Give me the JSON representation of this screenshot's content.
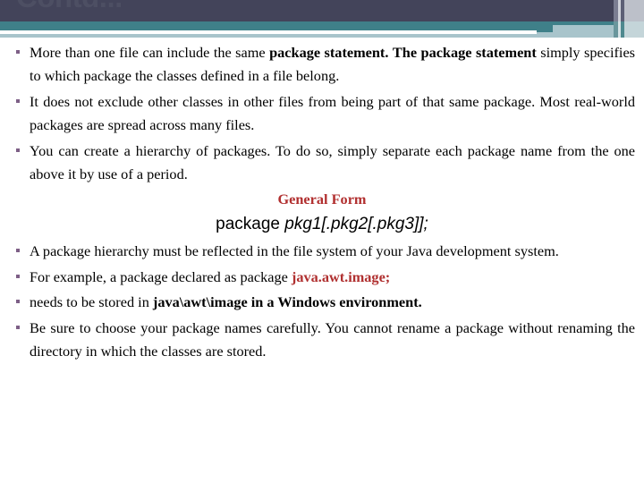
{
  "slide": {
    "title": "Contd...",
    "theme": {
      "band_dark": "#43445a",
      "band_teal": "#3f8089",
      "band_light_blue": "#a8c4cb",
      "title_color": "#4d4f63",
      "bullet_color": "#7d5f86",
      "accent_red": "#b12f2f",
      "body_color": "#000000"
    }
  },
  "body": {
    "bullets": [
      {
        "id": "bullet-package-statement",
        "segments": [
          {
            "text": "More than one file can include the same ",
            "style": "normal"
          },
          {
            "text": "package statement.",
            "style": "bold"
          },
          {
            "text": " ",
            "style": "normal"
          },
          {
            "text": "The package statement",
            "style": "bold"
          },
          {
            "text": " simply specifies to which package the classes defined in a file belong.",
            "style": "normal"
          }
        ]
      },
      {
        "id": "bullet-not-exclude",
        "segments": [
          {
            "text": "It does not exclude other classes in other files from being part of that same package. Most real-world packages are spread across many files.",
            "style": "normal"
          }
        ]
      },
      {
        "id": "bullet-hierarchy",
        "segments": [
          {
            "text": "You can create a hierarchy of packages. To do so, simply separate each package name from the one above it by use of a period.",
            "style": "normal"
          }
        ]
      }
    ],
    "general_form": {
      "label": "General Form",
      "syntax_keyword": "package ",
      "syntax_argument": "pkg1[.pkg2[.pkg3]];"
    },
    "bullets_after": [
      {
        "id": "bullet-file-system",
        "segments": [
          {
            "text": "A package hierarchy must be reflected in the file system of your Java development system.",
            "style": "normal"
          }
        ]
      },
      {
        "id": "bullet-example",
        "segments": [
          {
            "text": "For example, a package declared as package ",
            "style": "normal"
          },
          {
            "text": "java.awt.image;",
            "style": "red"
          }
        ]
      },
      {
        "id": "bullet-windows-path",
        "segments": [
          {
            "text": "needs to be stored in ",
            "style": "normal"
          },
          {
            "text": "java\\awt\\image in a Windows environment.",
            "style": "bold"
          }
        ]
      },
      {
        "id": "bullet-rename-warning",
        "segments": [
          {
            "text": "Be sure to choose your package names carefully. You cannot rename a package without renaming the directory in which the classes are stored.",
            "style": "normal"
          }
        ]
      }
    ]
  }
}
